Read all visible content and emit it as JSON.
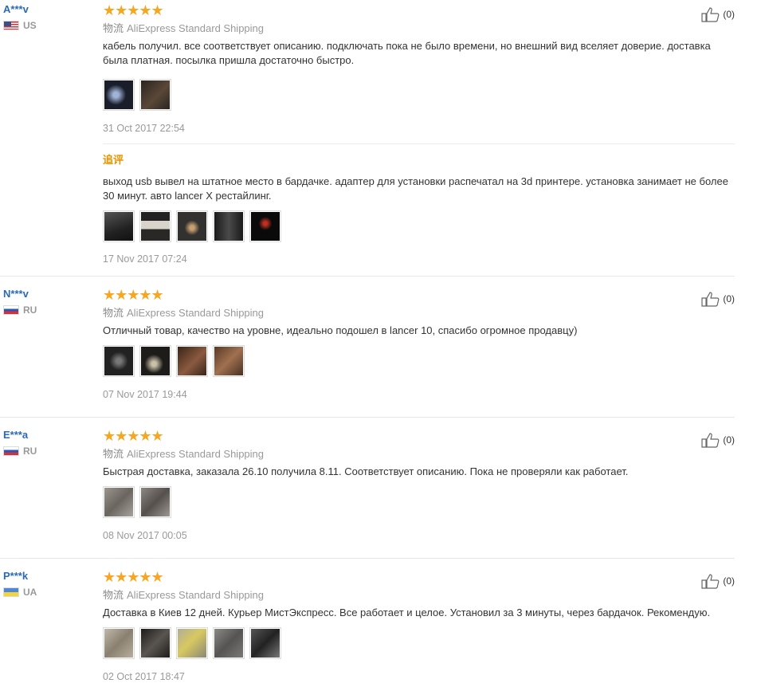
{
  "reviews": [
    {
      "user": "A***v",
      "country": "US",
      "flag": "flag-us",
      "shipping_label": "物流",
      "shipping": "AliExpress Standard Shipping",
      "text": "кабель получил. все соответствует описанию. подключать пока не было времени, но внешний вид вселяет доверие. доставка была платная. посылка пришла достаточно быстро.",
      "date": "31 Oct 2017 22:54",
      "helpful": "(0)",
      "photo_colors": [
        "#1a1e2a",
        "#3b2f26"
      ],
      "append": {
        "title": "追评",
        "text": "выход usb вывел на штатное место в бардачке. адаптер для установки распечатал на 3d принтере. установка занимает не более 30 минут. авто lancer X рестайлинг.",
        "date": "17 Nov 2017 07:24",
        "photo_colors": [
          "#2e2e2e",
          "#4a4540",
          "#333130",
          "#262626",
          "#111111"
        ]
      }
    },
    {
      "user": "N***v",
      "country": "RU",
      "flag": "flag-ru",
      "shipping_label": "物流",
      "shipping": "AliExpress Standard Shipping",
      "text": "Отличный товар, качество на уровне, идеально подошел в lancer 10, спасибо огромное продавцу)",
      "date": "07 Nov 2017 19:44",
      "helpful": "(0)",
      "photo_colors": [
        "#252525",
        "#3a342c",
        "#5a3a2e",
        "#6a4a38"
      ]
    },
    {
      "user": "E***a",
      "country": "RU",
      "flag": "flag-ru",
      "shipping_label": "物流",
      "shipping": "AliExpress Standard Shipping",
      "text": "Быстрая доставка, заказала 26.10 получила 8.11. Соответствует описанию. Пока не проверяли как работает.",
      "date": "08 Nov 2017 00:05",
      "helpful": "(0)",
      "photo_colors": [
        "#8a8580",
        "#7d7873"
      ]
    },
    {
      "user": "P***k",
      "country": "UA",
      "flag": "flag-ua",
      "shipping_label": "物流",
      "shipping": "AliExpress Standard Shipping",
      "text": "Доставка в Киев 12 дней. Курьер МистЭкспресс. Все работает и целое. Установил за 3 минуты, через бардачок. Рекомендую.",
      "date": "02 Oct 2017 18:47",
      "helpful": "(0)",
      "photo_colors": [
        "#a99f92",
        "#2c2a28",
        "#9a9880",
        "#6e6d6a",
        "#3a3a3a"
      ]
    }
  ]
}
